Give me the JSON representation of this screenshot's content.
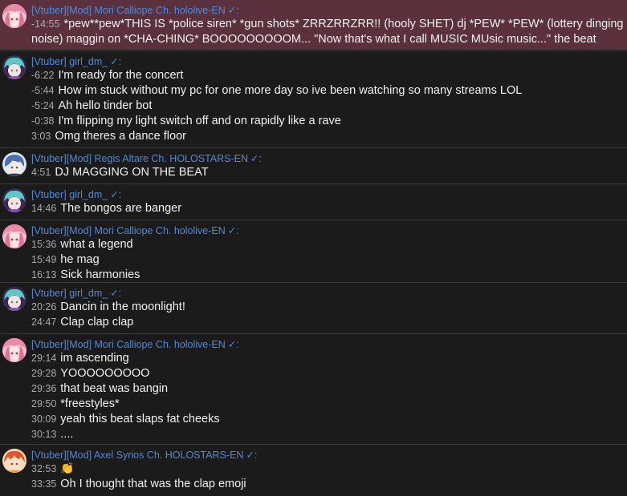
{
  "groups": [
    {
      "author": "[Vtuber][Mod] Mori Calliope Ch. hololive-EN",
      "avatar": "mori-calliope-avatar",
      "highlighted": true,
      "messages": [
        {
          "time": "-14:55",
          "text": "*pew**pew*THIS IS *police siren* *gun shots* ZRRZRRZRR!! (hooly SHET) dj *PEW* *PEW* (lottery dinging"
        },
        {
          "time": "",
          "text": "noise) maggin on *CHA-CHING* BOOOOOOOOOM... \"Now that's what I call MUSIC MUsic music...\" the beat"
        }
      ]
    },
    {
      "author": "[Vtuber] girl_dm_",
      "avatar": "girl-dm-avatar",
      "messages": [
        {
          "time": "-6:22",
          "text": "I'm ready for the concert"
        },
        {
          "time": "-5:44",
          "text": "How im stuck without my pc for one more day so ive been watching so many streams LOL"
        },
        {
          "time": "-5:24",
          "text": "Ah hello tinder bot"
        },
        {
          "time": "-0:38",
          "text": "I'm flipping my light switch off and on rapidly like a rave"
        },
        {
          "time": "3:03",
          "text": "Omg theres a dance floor"
        }
      ]
    },
    {
      "author": "[Vtuber][Mod] Regis Altare Ch. HOLOSTARS-EN",
      "avatar": "regis-altare-avatar",
      "messages": [
        {
          "time": "4:51",
          "text": "DJ MAGGING ON THE BEAT"
        }
      ]
    },
    {
      "author": "[Vtuber] girl_dm_",
      "avatar": "girl-dm-avatar",
      "messages": [
        {
          "time": "14:46",
          "text": "The bongos are banger"
        }
      ]
    },
    {
      "author": "[Vtuber][Mod] Mori Calliope Ch. hololive-EN",
      "avatar": "mori-calliope-avatar",
      "messages": [
        {
          "time": "15:36",
          "text": "what a legend"
        },
        {
          "time": "15:49",
          "text": "he mag"
        },
        {
          "time": "16:13",
          "text": "Sick harmonies"
        }
      ]
    },
    {
      "author": "[Vtuber] girl_dm_",
      "avatar": "girl-dm-avatar",
      "messages": [
        {
          "time": "20:26",
          "text": "Dancin in the moonlight!"
        },
        {
          "time": "24:47",
          "text": "Clap clap clap"
        }
      ]
    },
    {
      "author": "[Vtuber][Mod] Mori Calliope Ch. hololive-EN",
      "avatar": "mori-calliope-avatar",
      "messages": [
        {
          "time": "29:14",
          "text": "im ascending"
        },
        {
          "time": "29:28",
          "text": "YOOOOOOOOO"
        },
        {
          "time": "29:36",
          "text": "that beat was bangin"
        },
        {
          "time": "29:50",
          "text": "*freestyles*"
        },
        {
          "time": "30:09",
          "text": "yeah this beat slaps fat cheeks"
        },
        {
          "time": "30:13",
          "text": "...."
        }
      ]
    },
    {
      "author": "[Vtuber][Mod] Axel Syrios Ch. HOLOSTARS-EN",
      "avatar": "axel-syrios-avatar",
      "messages": [
        {
          "time": "32:53",
          "text": "",
          "emoji": "clapping-hands"
        },
        {
          "time": "33:35",
          "text": "Oh I thought that was the clap emoji"
        }
      ]
    }
  ],
  "verified_mark": "✓:",
  "clap_emoji": "👏",
  "colors": {
    "background": "#1b1b1b",
    "highlight": "#5a313c",
    "author": "#4e8ad9",
    "timestamp": "#a9a9a9",
    "message": "#f1f1f1"
  }
}
